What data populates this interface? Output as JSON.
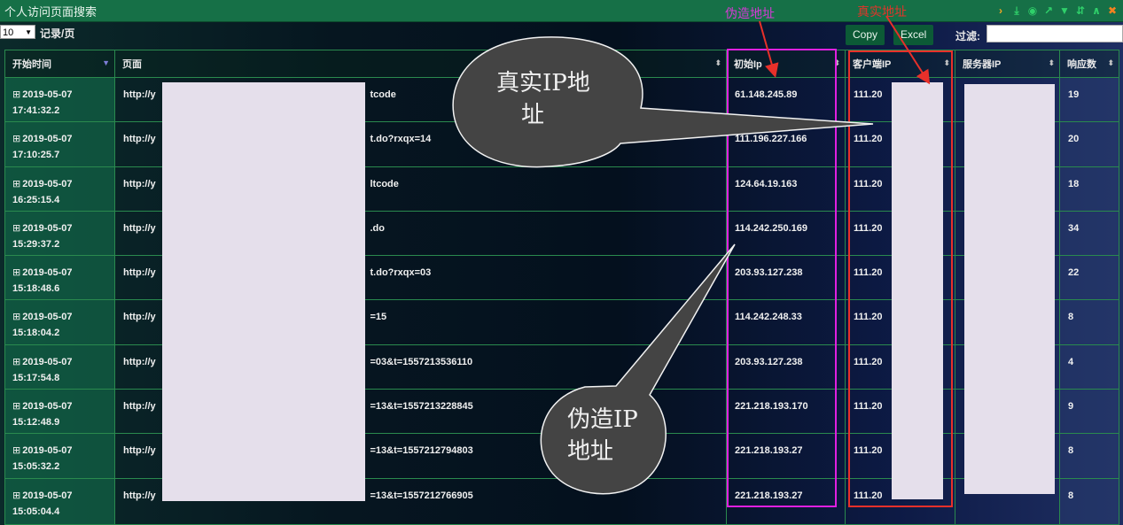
{
  "window": {
    "title": "个人访问页面搜索",
    "tool_icons": [
      "chevron-right-icon",
      "download-icon",
      "eye-icon",
      "line-chart-icon",
      "filter-icon",
      "sort-icon",
      "collapse-icon",
      "close-icon"
    ]
  },
  "toolbar": {
    "page_size": "10",
    "page_size_label": "记录/页",
    "copy_label": "Copy",
    "excel_label": "Excel",
    "filter_label": "过滤:",
    "filter_value": ""
  },
  "table": {
    "headers": {
      "start_time": "开始时间",
      "page": "页面",
      "initial_ip": "初始Ip",
      "client_ip": "客户端IP",
      "server_ip": "服务器IP",
      "response_count": "响应数"
    },
    "rows": [
      {
        "date": "2019-05-07",
        "time": "17:41:32.2",
        "page_prefix": "http://y",
        "page_suffix": "tcode",
        "initial_ip": "61.148.245.89",
        "client_ip": "111.20",
        "response": "19"
      },
      {
        "date": "2019-05-07",
        "time": "17:10:25.7",
        "page_prefix": "http://y",
        "page_suffix": "t.do?rxqx=14",
        "initial_ip": "111.196.227.166",
        "client_ip": "111.20",
        "response": "20"
      },
      {
        "date": "2019-05-07",
        "time": "16:25:15.4",
        "page_prefix": "http://y",
        "page_suffix": "ltcode",
        "initial_ip": "124.64.19.163",
        "client_ip": "111.20",
        "response": "18"
      },
      {
        "date": "2019-05-07",
        "time": "15:29:37.2",
        "page_prefix": "http://y",
        "page_suffix": ".do",
        "initial_ip": "114.242.250.169",
        "client_ip": "111.20",
        "response": "34"
      },
      {
        "date": "2019-05-07",
        "time": "15:18:48.6",
        "page_prefix": "http://y",
        "page_suffix": "t.do?rxqx=03",
        "initial_ip": "203.93.127.238",
        "client_ip": "111.20",
        "response": "22"
      },
      {
        "date": "2019-05-07",
        "time": "15:18:04.2",
        "page_prefix": "http://y",
        "page_suffix": "=15",
        "initial_ip": "114.242.248.33",
        "client_ip": "111.20",
        "response": "8"
      },
      {
        "date": "2019-05-07",
        "time": "15:17:54.8",
        "page_prefix": "http://y",
        "page_suffix": "=03&t=1557213536110",
        "initial_ip": "203.93.127.238",
        "client_ip": "111.20",
        "response": "4"
      },
      {
        "date": "2019-05-07",
        "time": "15:12:48.9",
        "page_prefix": "http://y",
        "page_suffix": "=13&t=1557213228845",
        "initial_ip": "221.218.193.170",
        "client_ip": "111.20",
        "response": "9"
      },
      {
        "date": "2019-05-07",
        "time": "15:05:32.2",
        "page_prefix": "http://y",
        "page_suffix": "=13&t=1557212794803",
        "initial_ip": "221.218.193.27",
        "client_ip": "111.20",
        "response": "8"
      },
      {
        "date": "2019-05-07",
        "time": "15:05:04.4",
        "page_prefix": "http://y",
        "page_suffix": "=13&t=1557212766905",
        "initial_ip": "221.218.193.27",
        "client_ip": "111.20",
        "response": "8"
      }
    ]
  },
  "annotations": {
    "fake_label": "伪造地址",
    "real_label": "真实地址",
    "real_bubble": [
      "真实IP地",
      "址"
    ],
    "fake_bubble": [
      "伪造IP",
      "地址"
    ],
    "colors": {
      "fake": "#d63ad6",
      "real": "#e0352a",
      "bubble": "#444444"
    }
  }
}
